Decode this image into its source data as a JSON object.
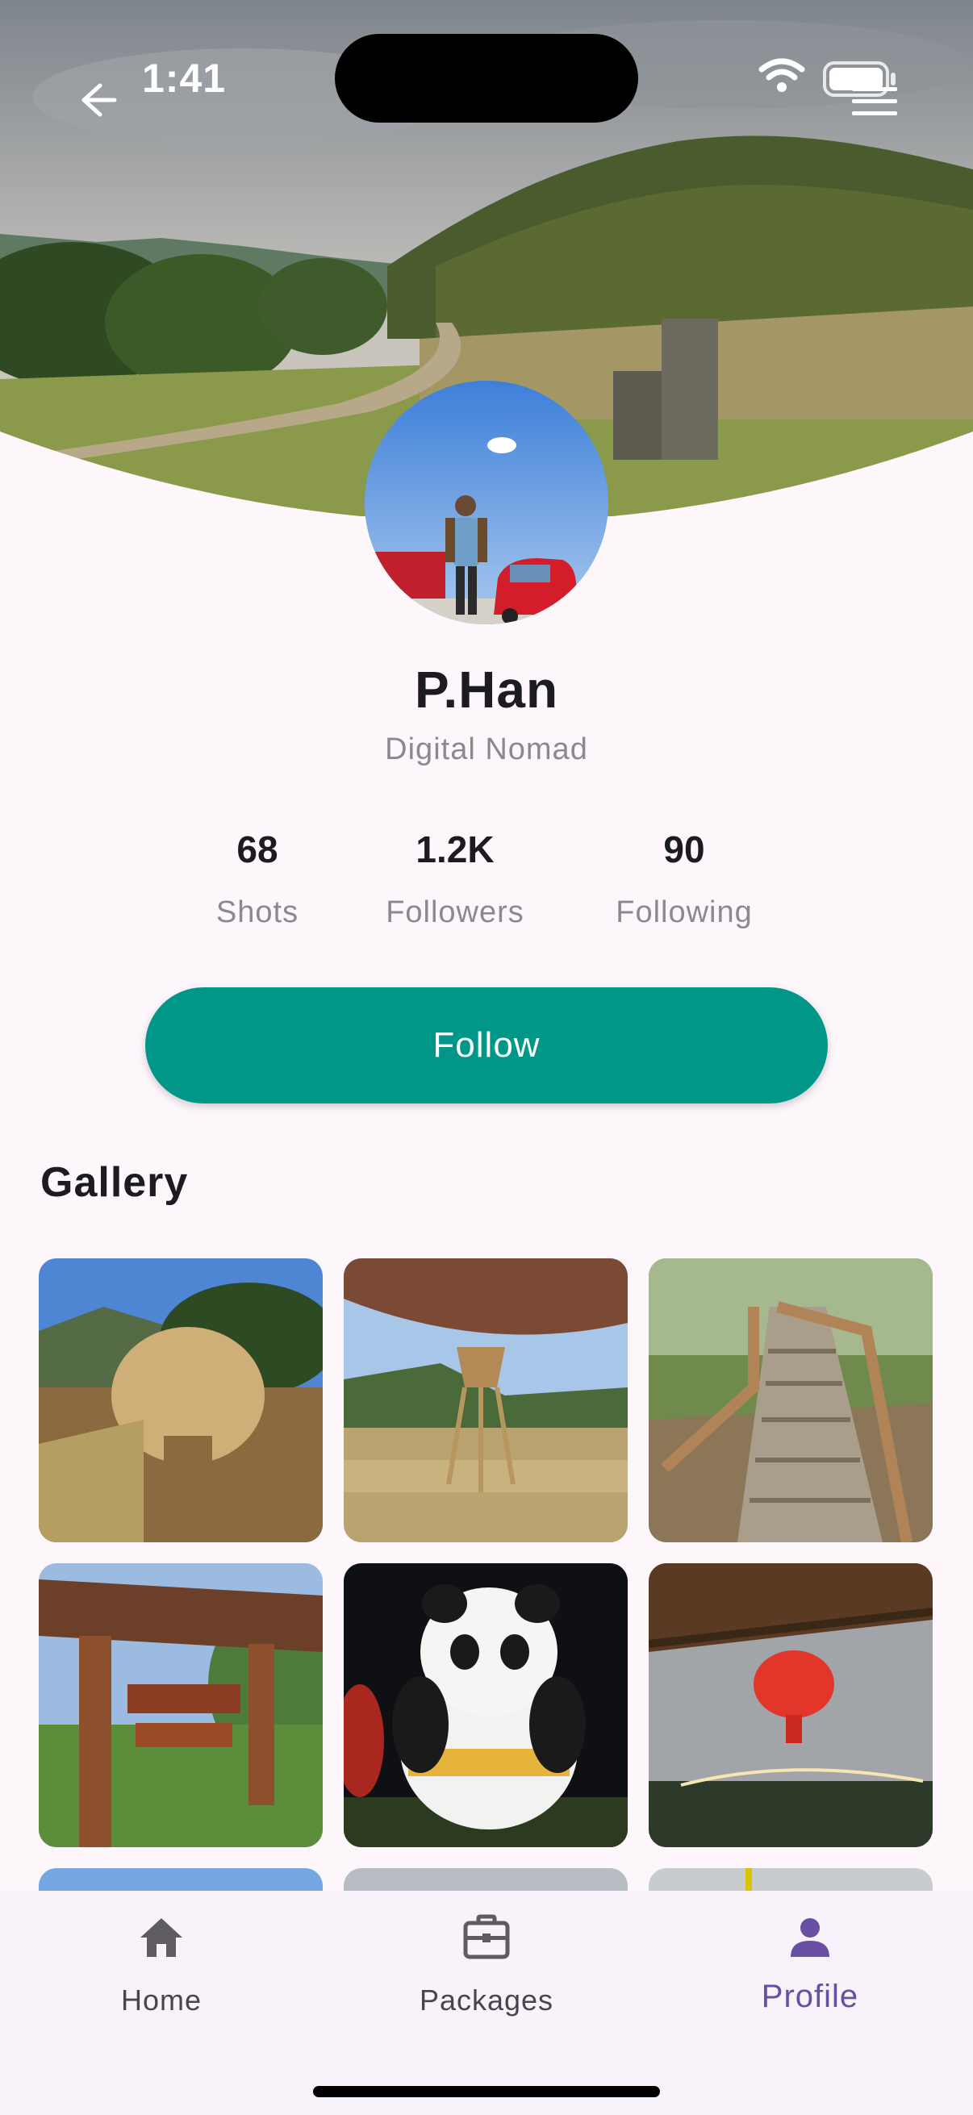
{
  "status_bar": {
    "time": "1:41"
  },
  "icons": {
    "back": "arrow-left-icon",
    "wifi": "wifi-icon",
    "battery": "battery-icon",
    "menu": "menu-icon"
  },
  "profile": {
    "name": "P.Han",
    "role": "Digital Nomad",
    "stats": [
      {
        "value": "68",
        "label": "Shots"
      },
      {
        "value": "1.2K",
        "label": "Followers"
      },
      {
        "value": "90",
        "label": "Following"
      }
    ],
    "follow_label": "Follow"
  },
  "gallery": {
    "title": "Gallery",
    "items": [
      "dried-flower-basket-photo",
      "hanging-lantern-photo",
      "wooden-stairs-photo",
      "tourist-sign-photo",
      "panda-balloon-photo",
      "red-lantern-photo"
    ]
  },
  "nav": {
    "items": [
      {
        "label": "Home",
        "icon": "home-icon",
        "active": false
      },
      {
        "label": "Packages",
        "icon": "briefcase-icon",
        "active": false
      },
      {
        "label": "Profile",
        "icon": "person-icon",
        "active": true
      }
    ]
  },
  "colors": {
    "accent": "#009688",
    "active_nav": "#6750a4",
    "background": "#fdf7fc"
  }
}
